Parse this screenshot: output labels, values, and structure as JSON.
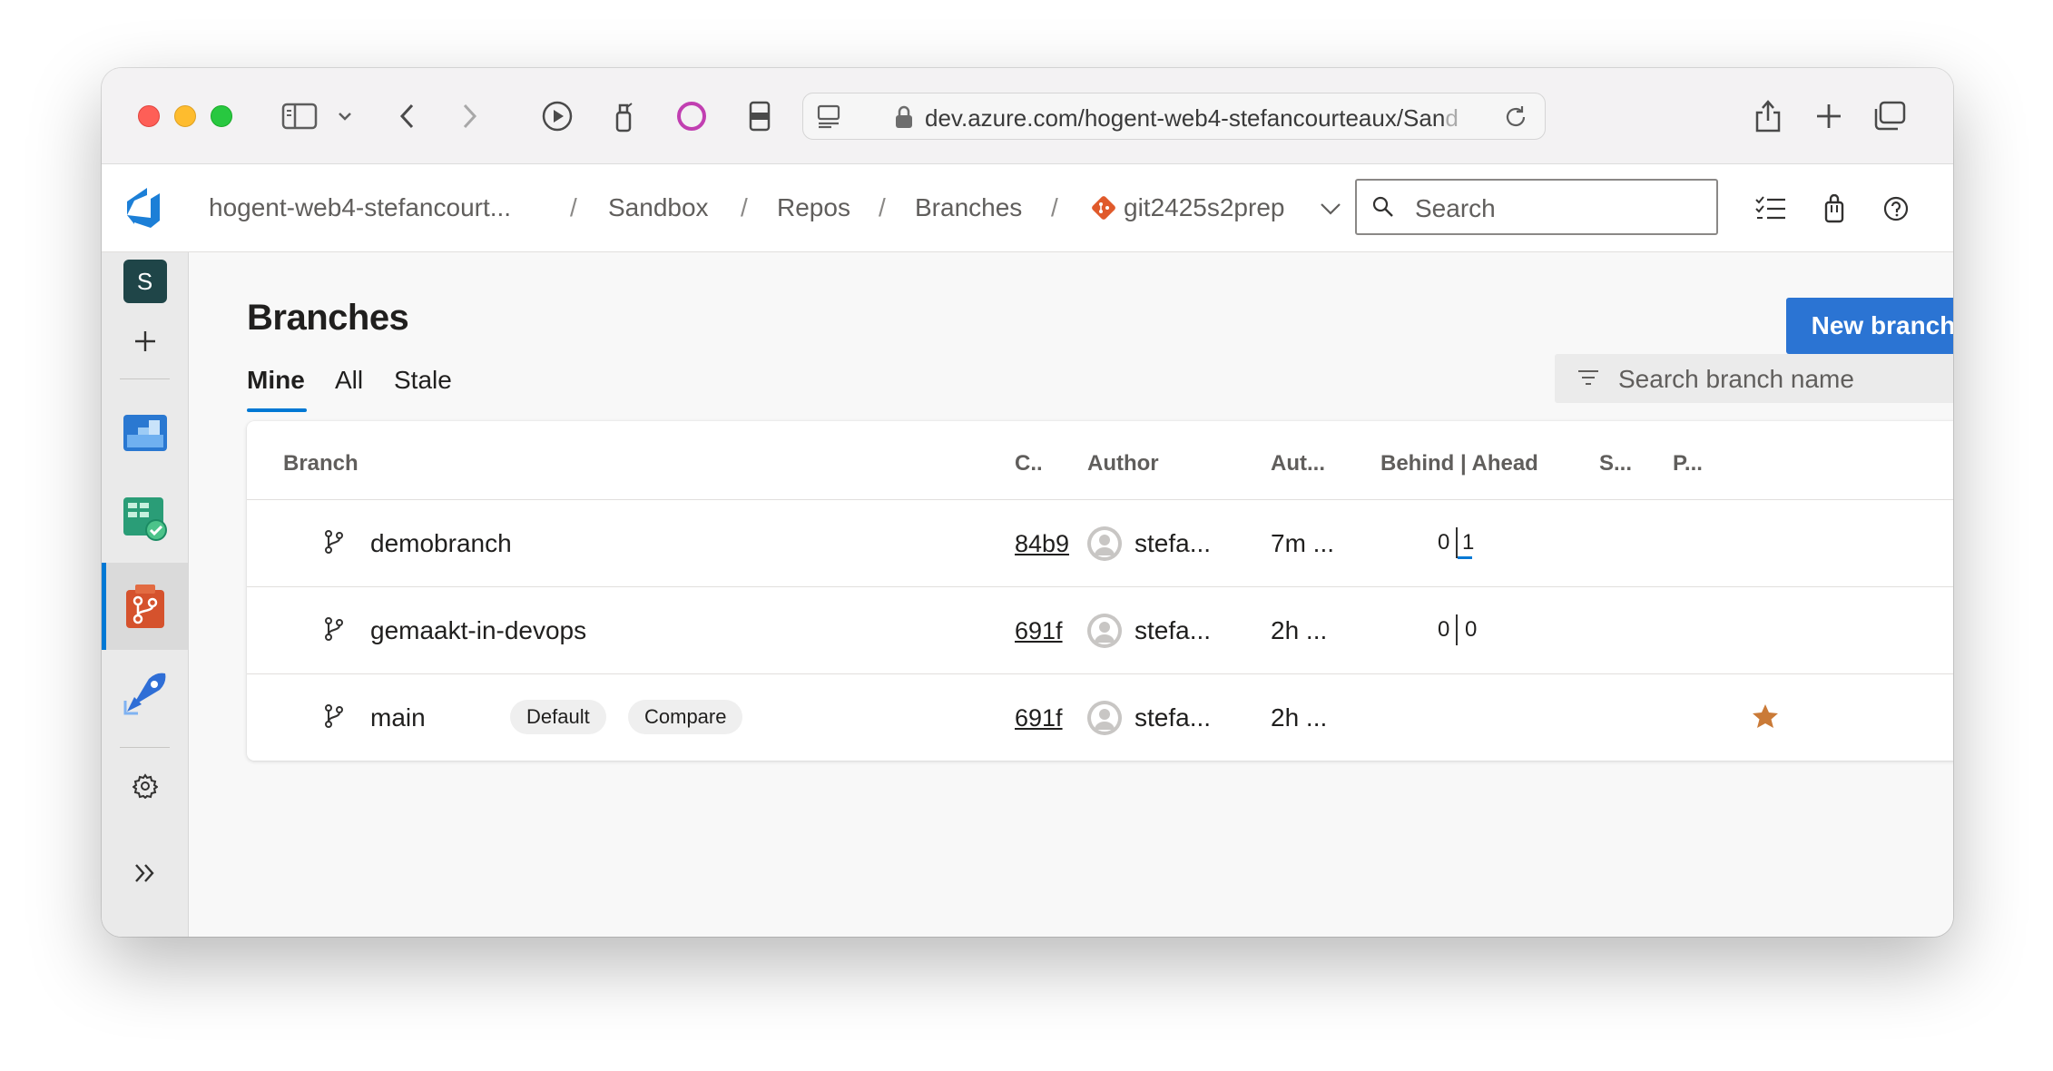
{
  "browser": {
    "url_main": "dev.azure.com/hogent-web4-stefancourteaux/San",
    "url_fade": "d"
  },
  "header": {
    "org": "hogent-web4-stefancourt...",
    "project": "Sandbox",
    "section": "Repos",
    "page": "Branches",
    "repo": "git2425s2prep",
    "search_placeholder": "Search",
    "separator": "/"
  },
  "sidebar": {
    "project_initial": "S"
  },
  "main": {
    "title": "Branches",
    "new_branch_label": "New branch",
    "tabs": [
      {
        "label": "Mine",
        "selected": true
      },
      {
        "label": "All",
        "selected": false
      },
      {
        "label": "Stale",
        "selected": false
      }
    ],
    "filter_placeholder": "Search branch name",
    "columns": {
      "branch": "Branch",
      "commit": "C..",
      "author": "Author",
      "authored": "Aut...",
      "behind_ahead": "Behind | Ahead",
      "status": "S...",
      "pr": "P..."
    },
    "rows": [
      {
        "name": "demobranch",
        "commit": "84b9",
        "author": "stefa...",
        "time": "7m ...",
        "behind": "0",
        "ahead": "1"
      },
      {
        "name": "gemaakt-in-devops",
        "commit": "691f",
        "author": "stefa...",
        "time": "2h ...",
        "behind": "0",
        "ahead": "0"
      },
      {
        "name": "main",
        "commit": "691f",
        "author": "stefa...",
        "time": "2h ...",
        "default_badge": "Default",
        "compare_badge": "Compare"
      }
    ]
  },
  "colors": {
    "accent": "#0078d4",
    "primary_button": "#2b74d3",
    "favorite_star": "#ca7a37",
    "repo_icon": "#e05a2b"
  }
}
